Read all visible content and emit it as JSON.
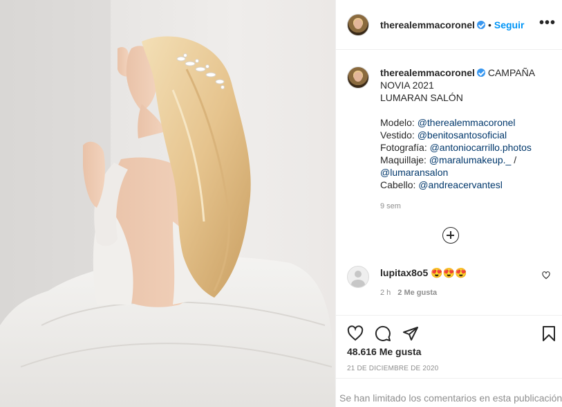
{
  "header": {
    "username": "therealemmacoronel",
    "dot": "•",
    "follow_label": "Seguir",
    "more_label": "•••"
  },
  "caption": {
    "username": "therealemmacoronel",
    "title_lines": [
      "CAMPAÑA",
      "NOVIA 2021",
      "LUMARAN SALÓN"
    ],
    "credits": [
      {
        "label": "Modelo: ",
        "handle": "@therealemmacoronel"
      },
      {
        "label": "Vestido: ",
        "handle": "@benitosantosoficial"
      },
      {
        "label": "Fotografía: ",
        "handle": "@antoniocarrillo.photos"
      },
      {
        "label": "Maquillaje: ",
        "handle": "@maralumakeup._",
        "suffix": " /"
      },
      {
        "label": "",
        "handle": "@lumaransalon"
      },
      {
        "label": "Cabello: ",
        "handle": "@andreacervantesl"
      }
    ],
    "time": "9 sem"
  },
  "comment": {
    "username": "lupitax8o5",
    "emoji": "😍😍😍",
    "time": "2 h",
    "likes": "2 Me gusta"
  },
  "likes_text": "48.616 Me gusta",
  "date_text": "21 DE DICIEMBRE DE 2020",
  "comments_limited": "Se han limitado los comentarios en esta publicación.",
  "colors": {
    "link": "#00376b",
    "follow": "#0095f6",
    "verified": "#3897f0",
    "muted": "#8e8e8e"
  },
  "icons": [
    "verified-badge-icon",
    "more-options-icon",
    "add-circle-icon",
    "heart-icon",
    "comment-icon",
    "share-icon",
    "bookmark-icon"
  ]
}
